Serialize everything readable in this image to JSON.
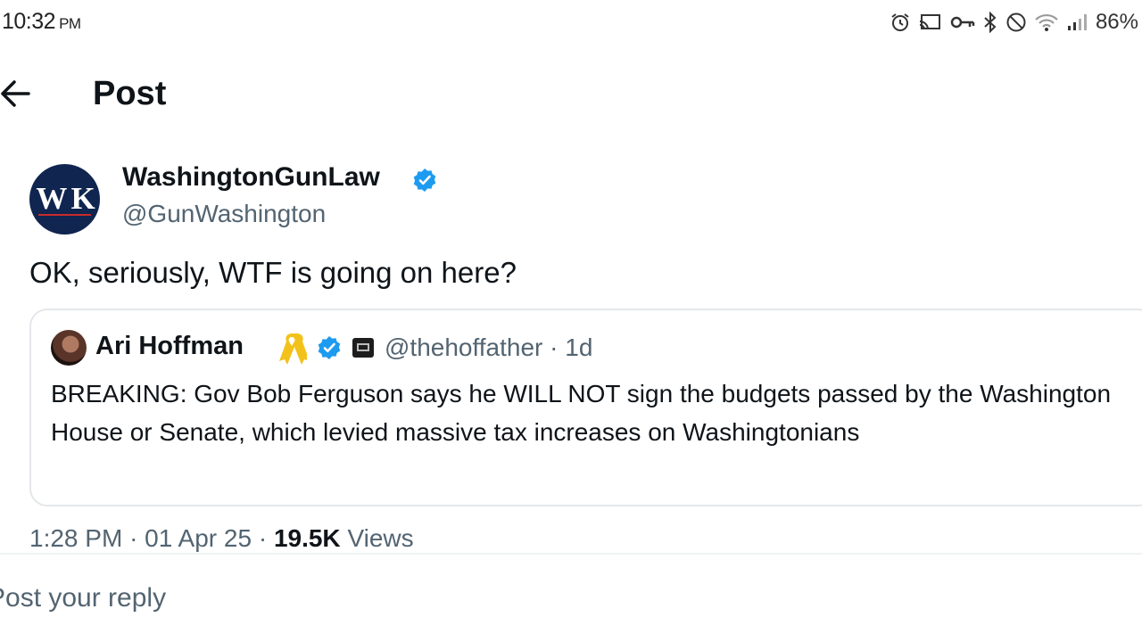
{
  "status_bar": {
    "time": "10:32",
    "ampm": "PM",
    "battery": "86%",
    "icons": [
      "alarm-icon",
      "cast-icon",
      "key-icon",
      "bluetooth-icon",
      "do-not-disturb-icon",
      "wifi-icon",
      "signal-icon"
    ]
  },
  "header": {
    "back_icon": "arrow-left-icon",
    "title": "Post"
  },
  "tweet": {
    "avatar_text": "W K",
    "author_name": "WashingtonGunLaw",
    "handle": "@GunWashington",
    "text": "OK, seriously, WTF is going on here?",
    "time": "1:28 PM",
    "date": "01 Apr 25",
    "separator": "·",
    "views_count": "19.5K",
    "views_label": "Views"
  },
  "quoted": {
    "author_name": "Ari Hoffman",
    "handle": "@thehoffather",
    "age": "1d",
    "text": "BREAKING: Gov Bob Ferguson says he WILL NOT sign the budgets passed by the Washington House or Senate, which levied massive tax increases on Washingtonians"
  },
  "reply": {
    "placeholder": "Post your reply"
  },
  "colors": {
    "verified": "#1d9bf0",
    "secondary_text": "#536471",
    "avatar_bg": "#10254f",
    "ribbon": "#f2c21b"
  }
}
